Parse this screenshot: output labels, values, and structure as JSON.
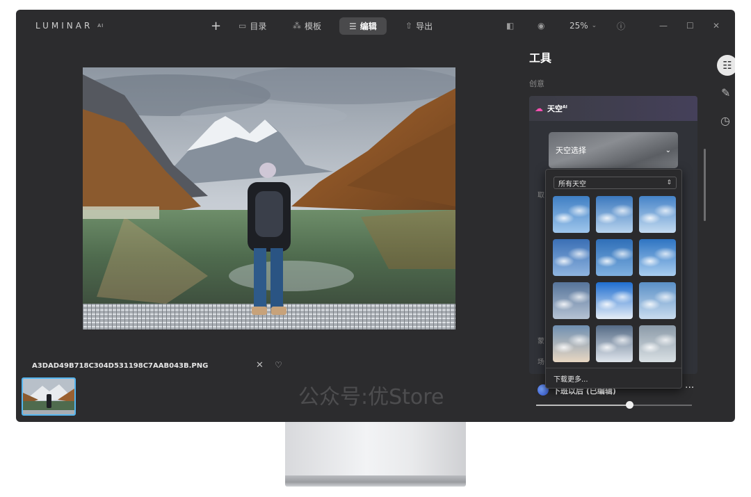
{
  "app": {
    "logo": "LUMINAR",
    "logo_sup": "AI"
  },
  "topbar": {
    "add": "+",
    "catalog": "目录",
    "templates": "模板",
    "edit": "编辑",
    "export": "导出",
    "zoom": "25%"
  },
  "filmstrip": {
    "filename": "A3DAD49B718C304D531198C7AAB043B.PNG"
  },
  "watermark": "公众号:优Store",
  "panel": {
    "title": "工具",
    "section": "创意",
    "sky_tool_label": "天空",
    "sky_tool_sup": "AI",
    "sky_select_label": "天空选择",
    "row_take": "取",
    "row_mask": "蒙",
    "row_scene": "场",
    "preset_name": "下班以后 (已编辑)",
    "preset_more": "···",
    "preset_amount": 0.6
  },
  "dropdown": {
    "filter_label": "所有天空",
    "more_label": "下载更多...",
    "skies": [
      "cumulus-1",
      "cumulus-2",
      "cumulus-3",
      "wispy-1",
      "blue-soft",
      "blue-light",
      "mackerel",
      "bright-cumulus",
      "streaks",
      "sunset-haze",
      "stormy-cumulus",
      "overcast"
    ]
  },
  "icons": {
    "catalog": "folder-icon",
    "templates": "sparkle-icon",
    "edit": "sliders-icon",
    "export": "share-icon",
    "compare": "compare-icon",
    "eye": "eye-icon",
    "help": "help-icon",
    "close": "close-icon",
    "heart": "heart-icon",
    "brush": "brush-icon",
    "clock": "history-icon",
    "cloud": "cloud-icon"
  },
  "colors": {
    "accent_pink": "#ff4fb2",
    "thumb_border": "#55b6f0",
    "app_bg": "#2c2c2e"
  }
}
